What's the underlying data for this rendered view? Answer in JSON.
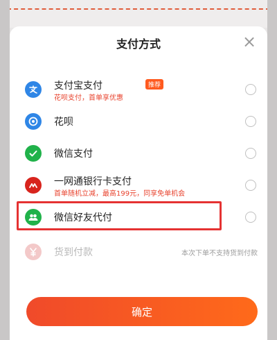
{
  "colors": {
    "accent": "#ff5a1f",
    "promo_text": "#e8432e",
    "highlight": "#e53232",
    "alipay": "#2f86e6",
    "huabei": "#2f86e6",
    "wechat": "#20b24a",
    "bank": "#d8241d",
    "wechat_friend": "#20b24a",
    "cod": "#f3c9c9",
    "dash": "#e05c3a"
  },
  "sheet": {
    "title": "支付方式",
    "close_icon": "close-icon"
  },
  "methods": [
    {
      "name": "支付宝支付",
      "sub": "花呗支付，首单享优惠",
      "badge": "推荐",
      "icon": "alipay-icon"
    },
    {
      "name": "花呗",
      "icon": "huabei-icon"
    },
    {
      "name": "微信支付",
      "icon": "wechat-pay-icon"
    },
    {
      "name": "一网通银行卡支付",
      "sub": "首单随机立减，最高199元，同享免单机会",
      "icon": "cmb-bank-icon"
    },
    {
      "name": "微信好友代付",
      "icon": "wechat-friend-pay-icon"
    },
    {
      "name": "货到付款",
      "note": "本次下单不支持货到付款",
      "icon": "cash-on-delivery-icon"
    }
  ],
  "confirm_label": "确定"
}
